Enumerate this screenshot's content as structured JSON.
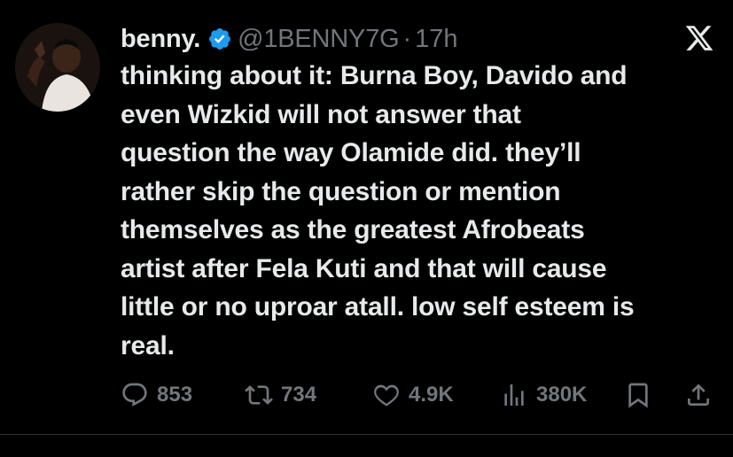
{
  "tweet": {
    "author_name": "benny.",
    "handle": "@1BENNY7G",
    "separator": "·",
    "time": "17h",
    "text": "thinking about it: Burna Boy, Davido and\neven Wizkid will not answer that\nquestion the way Olamide did. they’ll\nrather skip the question or mention\nthemselves as the greatest Afrobeats\nartist after Fela Kuti and that will cause\nlittle or no uproar atall. low self esteem is\nreal.",
    "verified_icon": "verified-badge-icon",
    "platform_icon": "x-logo-icon"
  },
  "actions": {
    "replies": "853",
    "reposts": "734",
    "likes": "4.9K",
    "views": "380K"
  },
  "colors": {
    "background": "#000000",
    "text": "#e7e9ea",
    "secondary": "#71767b",
    "verified": "#1d9bf0"
  }
}
